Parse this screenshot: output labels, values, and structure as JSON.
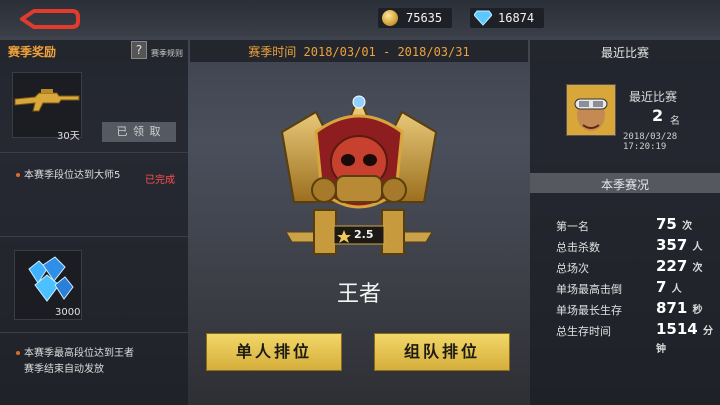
{
  "header": {
    "coins": "75635",
    "diamonds": "16874"
  },
  "rewards": {
    "title": "赛季奖励",
    "rules_icon": "?",
    "rules_label": "赛季规则",
    "reward1": {
      "qty": "30天",
      "claimed_label": "已 领 取",
      "task": "本赛季段位达到大师5",
      "status": "已完成"
    },
    "reward2": {
      "qty": "3000",
      "task_line1": "本赛季最高段位达到王者",
      "task_line2": "赛季结束自动发放"
    }
  },
  "season": {
    "time_label": "赛季时间 2018/03/01 - 2018/03/31",
    "badge_stars": "2.5",
    "rank_name": "王者",
    "solo_button": "单人排位",
    "team_button": "组队排位"
  },
  "recent": {
    "title": "最近比赛",
    "label": "最近比赛",
    "rank": "2",
    "rank_unit": "名",
    "time": "2018/03/28 17:20:19"
  },
  "stats": {
    "title": "本季赛况",
    "rows": [
      {
        "label": "第一名",
        "value": "75",
        "unit": "次"
      },
      {
        "label": "总击杀数",
        "value": "357",
        "unit": "人"
      },
      {
        "label": "总场次",
        "value": "227",
        "unit": "次"
      },
      {
        "label": "单场最高击倒",
        "value": "7",
        "unit": "人"
      },
      {
        "label": "单场最长生存",
        "value": "871",
        "unit": "秒"
      },
      {
        "label": "总生存时间",
        "value": "1514",
        "unit": "分钟"
      }
    ]
  },
  "colors": {
    "accent": "#f0a23a",
    "gold_button": "#e6c24f",
    "done": "#ff4f4f"
  }
}
